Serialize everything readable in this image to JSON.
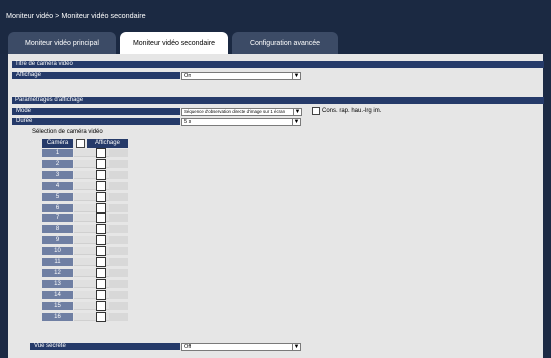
{
  "breadcrumb": "Moniteur vidéo > Moniteur vidéo secondaire",
  "tabs": [
    {
      "label": "Moniteur vidéo principal",
      "active": false
    },
    {
      "label": "Moniteur vidéo secondaire",
      "active": true
    },
    {
      "label": "Configuration avancée",
      "active": false
    }
  ],
  "title_section": {
    "heading": "Titre de caméra vidéo",
    "display_label": "Affichage",
    "display_value": "On"
  },
  "display_section": {
    "heading": "Paramétrages d'affichage",
    "mode_label": "Mode",
    "mode_value": "Séquence d'observation directe d'image sur 1 écran",
    "aspect_label": "Cons. rap. hau.-lrg im.",
    "aspect_checked": false,
    "duration_label": "Durée",
    "duration_value": "5 s",
    "camera_selection_label": "Sélection de caméra vidéo",
    "camera_col": "Caméra",
    "display_col": "Affichage",
    "cameras": [
      "1",
      "2",
      "3",
      "4",
      "5",
      "6",
      "7",
      "8",
      "9",
      "10",
      "11",
      "12",
      "13",
      "14",
      "15",
      "16"
    ],
    "secret_label": "Vue secrète",
    "secret_value": "Off"
  },
  "colors": {
    "header_bg": "#1b2942",
    "section_bar": "#253a69",
    "camera_number_bg": "#6f7fa3",
    "panel_bg": "#e6e6e6"
  },
  "icons": {
    "dropdown": "chevron-down-icon"
  }
}
